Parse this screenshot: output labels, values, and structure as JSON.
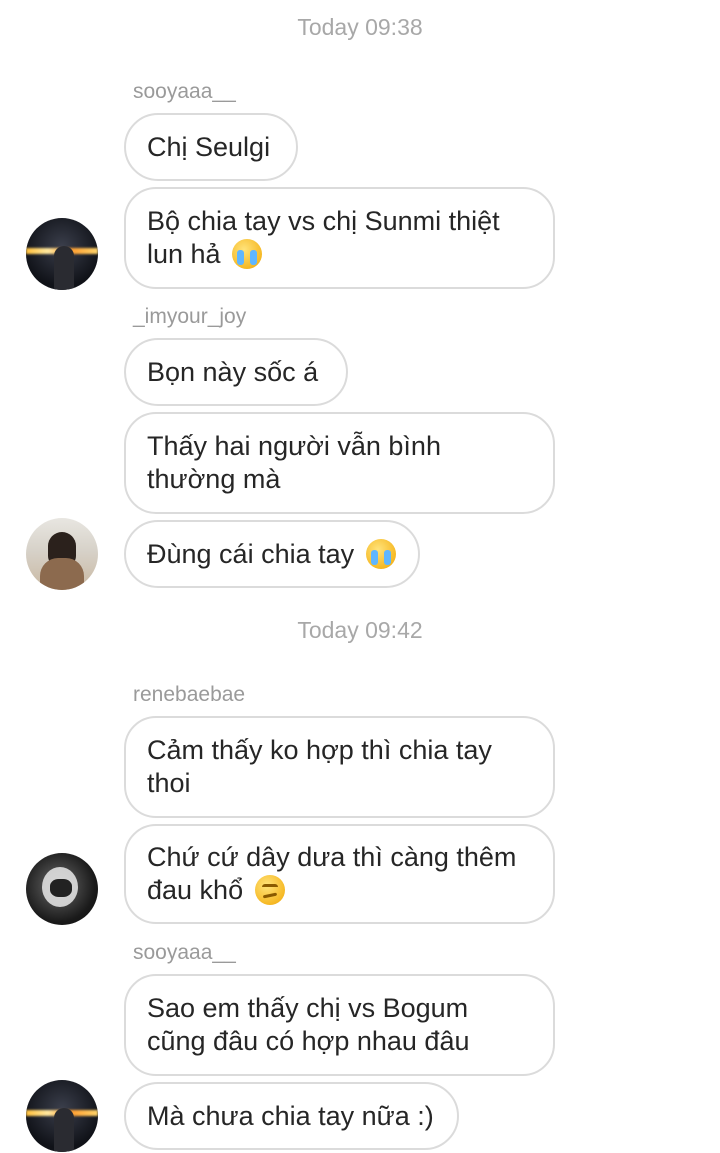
{
  "timestamps": [
    "Today 09:38",
    "Today 09:42"
  ],
  "groups": [
    {
      "username": "sooyaaa__",
      "messages": [
        {
          "text": "Chị Seulgi"
        },
        {
          "text": "Bộ chia tay vs chị Sunmi thiệt",
          "text2": "lun hả",
          "emoji": "loudly-crying-face"
        }
      ]
    },
    {
      "username": "_imyour_joy",
      "messages": [
        {
          "text": "Bọn này sốc á"
        },
        {
          "text": "Thấy hai người vẫn bình",
          "text2": "thường mà"
        },
        {
          "text": "Đùng cái chia tay",
          "emoji": "loudly-crying-face"
        }
      ]
    },
    {
      "username": "renebaebae",
      "messages": [
        {
          "text": "Cảm thấy ko hợp thì chia tay",
          "text2": "thoi"
        },
        {
          "text": "Chứ cứ dây dưa thì càng thêm",
          "text2": "đau khổ",
          "emoji": "smirking-face"
        }
      ]
    },
    {
      "username": "sooyaaa__",
      "messages": [
        {
          "text": "Sao em thấy chị vs Bogum",
          "text2": "cũng đâu có hợp nhau đâu"
        },
        {
          "text": "Mà chưa chia tay nữa :)"
        }
      ]
    }
  ],
  "colors": {
    "bubble_border": "#dbdbdb",
    "timestamp": "#a8a8a8",
    "username": "#9a9a9a",
    "text": "#262626"
  }
}
